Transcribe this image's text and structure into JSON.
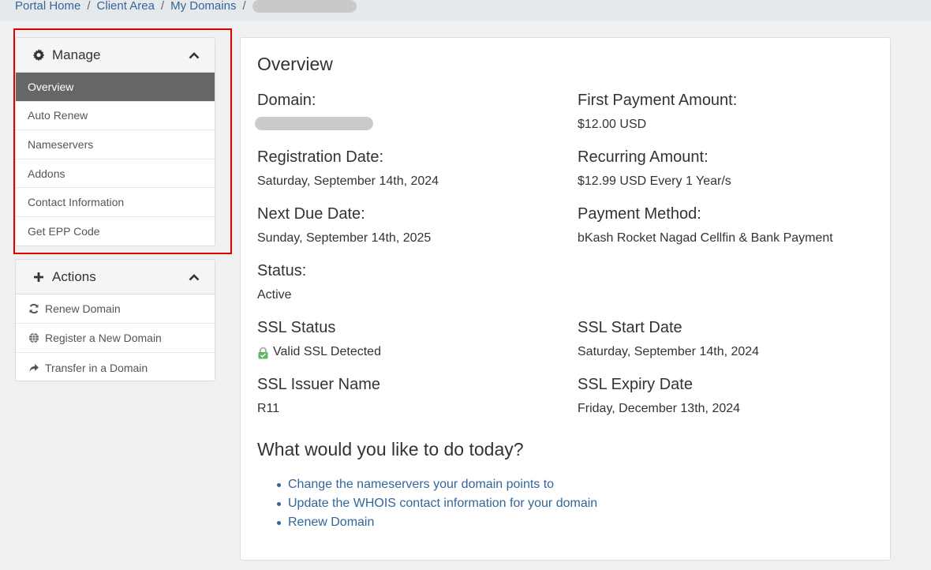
{
  "breadcrumb": {
    "items": [
      "Portal Home",
      "Client Area",
      "My Domains"
    ],
    "separator": "/"
  },
  "manage": {
    "title": "Manage",
    "items": [
      "Overview",
      "Auto Renew",
      "Nameservers",
      "Addons",
      "Contact Information",
      "Get EPP Code"
    ],
    "active_index": 0
  },
  "actions": {
    "title": "Actions",
    "items": [
      {
        "label": "Renew Domain",
        "icon": "refresh-icon"
      },
      {
        "label": "Register a New Domain",
        "icon": "globe-icon"
      },
      {
        "label": "Transfer in a Domain",
        "icon": "share-arrow-icon"
      }
    ]
  },
  "overview": {
    "title": "Overview",
    "domain_label": "Domain:",
    "first_payment_label": "First Payment Amount:",
    "first_payment_value": "$12.00 USD",
    "registration_label": "Registration Date:",
    "registration_value": "Saturday, September 14th, 2024",
    "recurring_label": "Recurring Amount:",
    "recurring_value": "$12.99 USD Every 1 Year/s",
    "next_due_label": "Next Due Date:",
    "next_due_value": "Sunday, September 14th, 2025",
    "payment_method_label": "Payment Method:",
    "payment_method_value": "bKash Rocket Nagad Cellfin & Bank Payment",
    "status_label": "Status:",
    "status_value": "Active",
    "ssl_status_label": "SSL Status",
    "ssl_status_value": "Valid SSL Detected",
    "ssl_start_label": "SSL Start Date",
    "ssl_start_value": "Saturday, September 14th, 2024",
    "ssl_issuer_label": "SSL Issuer Name",
    "ssl_issuer_value": "R11",
    "ssl_expiry_label": "SSL Expiry Date",
    "ssl_expiry_value": "Friday, December 13th, 2024"
  },
  "todo": {
    "title": "What would you like to do today?",
    "links": [
      "Change the nameservers your domain points to",
      "Update the WHOIS contact information for your domain",
      "Renew Domain"
    ]
  },
  "colors": {
    "link": "#336699",
    "active_bg": "#666666",
    "highlight": "#e00000",
    "ssl_lock": "#5cb85c"
  }
}
